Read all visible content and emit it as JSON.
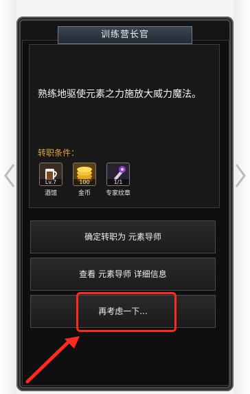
{
  "dialog": {
    "title": "训练营长官",
    "description": "熟练地驱使元素之力施放大威力魔法。",
    "conditions_label": "转职条件：",
    "requirements": [
      {
        "name": "酒馆",
        "value": "Lv.7",
        "icon": "tavern-icon"
      },
      {
        "name": "金币",
        "value": "100",
        "icon": "gold-coins-icon"
      },
      {
        "name": "专家纹章",
        "value": "1/1",
        "icon": "expert-badge-icon"
      }
    ]
  },
  "actions": {
    "confirm_label": "确定转职为 元素导师",
    "details_label": "查看 元素导师 详细信息",
    "reconsider_label": "再考虑一下..."
  },
  "colors": {
    "accent_orange": "#e0a53a",
    "highlight_red": "#ff2a1f",
    "panel_bg": "#151515"
  }
}
